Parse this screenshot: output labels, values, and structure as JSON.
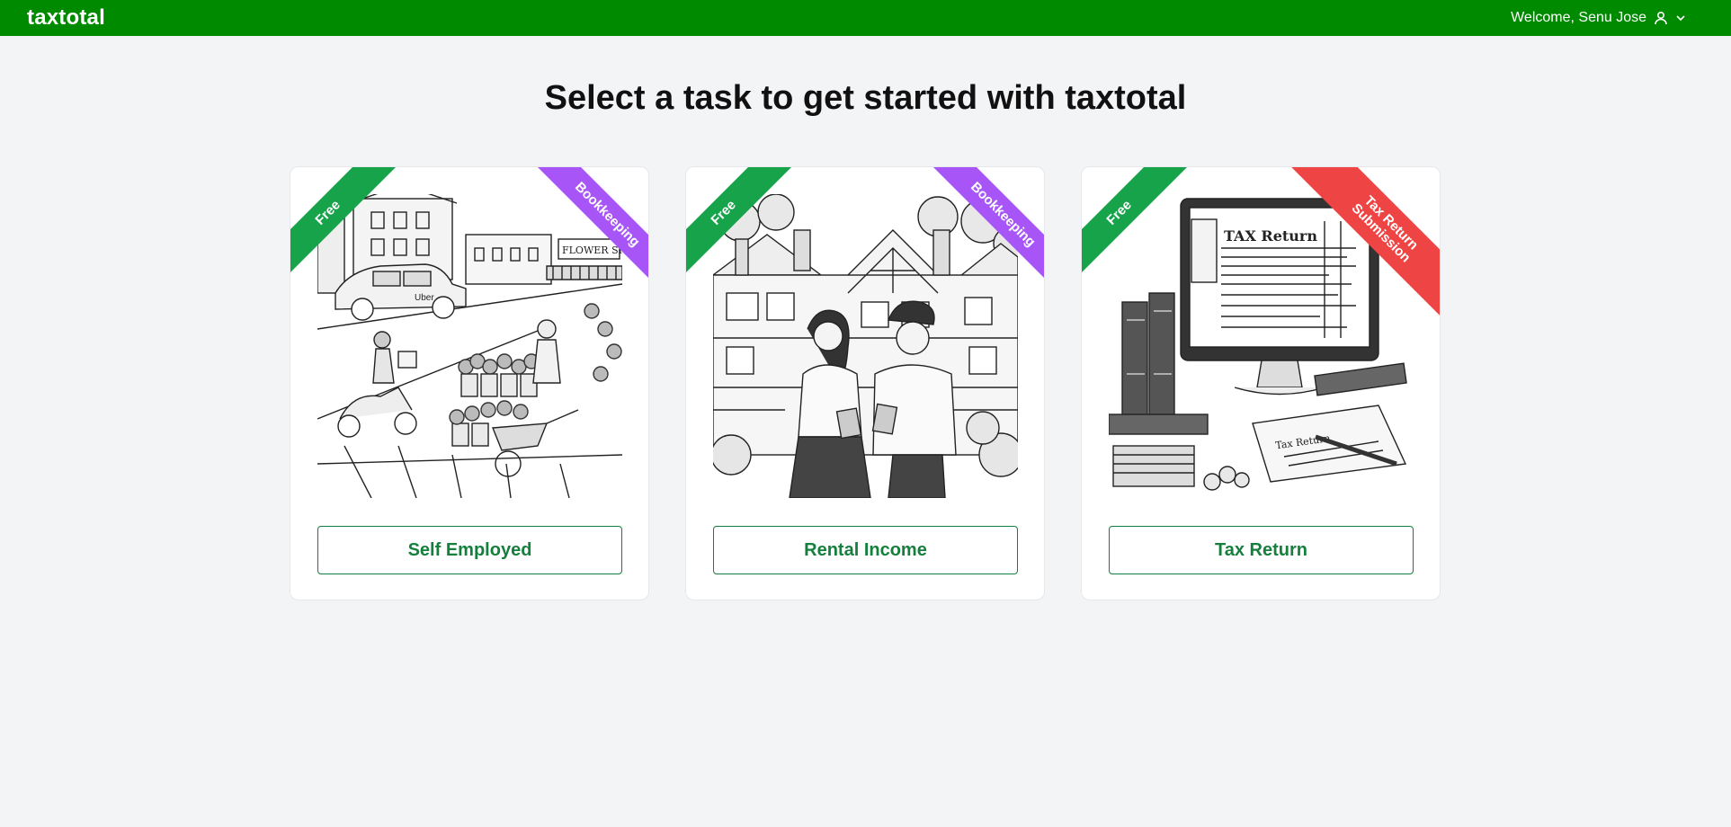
{
  "app": {
    "logo": "taxtotal",
    "welcome": "Welcome, Senu Jose",
    "brand_color": "#008a00"
  },
  "page": {
    "title": "Select a task to get started with taxtotal"
  },
  "cards": [
    {
      "button_label": "Self Employed",
      "ribbon_left": "Free",
      "ribbon_right": "Bookkeeping",
      "illustration": "street-scene-uber-flower-shop"
    },
    {
      "button_label": "Rental Income",
      "ribbon_left": "Free",
      "ribbon_right": "Bookkeeping",
      "illustration": "couple-counting-money-in-front-of-house"
    },
    {
      "button_label": "Tax Return",
      "ribbon_left": "Free",
      "ribbon_right_line1": "Tax Return",
      "ribbon_right_line2": "Submission",
      "illustration": "computer-tax-return-books-money",
      "monitor_heading": "TAX Return"
    }
  ],
  "colors": {
    "free": "#16a34a",
    "bookkeeping": "#a855f7",
    "tax_submission": "#ef4444",
    "button": "#15803d"
  }
}
